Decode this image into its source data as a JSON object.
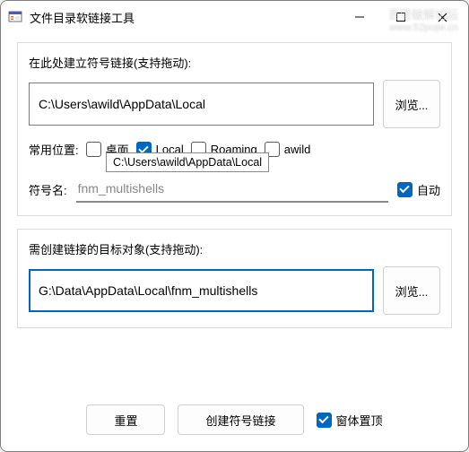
{
  "titlebar": {
    "title": "文件目录软链接工具"
  },
  "watermark": {
    "line1": "吾爱破解论坛",
    "line2": "www.52pojie.cn"
  },
  "source": {
    "label": "在此处建立符号链接(支持拖动):",
    "path": "C:\\Users\\awild\\AppData\\Local",
    "browse": "浏览..."
  },
  "common": {
    "label": "常用位置:",
    "options": [
      {
        "label": "桌面",
        "checked": false
      },
      {
        "label": "Local",
        "checked": true
      },
      {
        "label": "Roaming",
        "checked": false
      },
      {
        "label": "awild",
        "checked": false
      }
    ]
  },
  "symbol": {
    "label": "符号名:",
    "value": "fnm_multishells",
    "auto_label": "自动",
    "auto_checked": true,
    "tooltip": "C:\\Users\\awild\\AppData\\Local"
  },
  "target": {
    "label": "需创建链接的目标对象(支持拖动):",
    "path": "G:\\Data\\AppData\\Local\\fnm_multishells",
    "browse": "浏览..."
  },
  "footer": {
    "reset": "重置",
    "create": "创建符号链接",
    "topmost_label": "窗体置顶",
    "topmost_checked": true
  }
}
